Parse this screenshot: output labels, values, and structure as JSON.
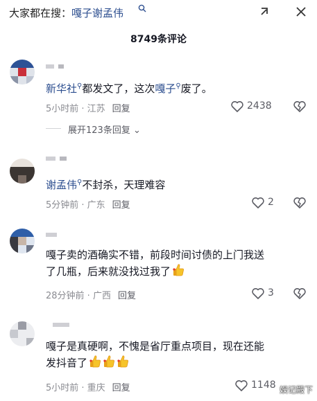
{
  "search": {
    "prefix": "大家都在搜：",
    "term": "嘎子谢孟伟"
  },
  "comment_count": "8749条评论",
  "comments": [
    {
      "author": "新华社",
      "text_main": "都发文了，这次",
      "text_mention": "嘎子",
      "text_tail": "废了。",
      "meta": "5小时前 · 江苏",
      "reply_label": "回复",
      "likes": "2438",
      "expand_label": "展开123条回复"
    },
    {
      "author": "谢孟伟",
      "text": "不封杀，天理难容",
      "meta": "5分钟前 · 广东",
      "reply_label": "回复",
      "likes": "2"
    },
    {
      "text_line1": "嘎子卖的酒确实不错，前段时间讨债的上门我送",
      "text_line2": "了几瓶，后来就没找过我了",
      "meta": "28分钟前 · 广西",
      "reply_label": "回复",
      "likes": "3"
    },
    {
      "text_line1": "嘎子是真硬啊，不愧是省厅重点项目，现在还能",
      "text_line2": "发抖音了",
      "meta": "5小时前 · 重庆",
      "reply_label": "回复",
      "likes": "1148"
    }
  ],
  "icons": {
    "expand": "expand-icon",
    "close": "close-icon",
    "search_mini": "search-icon",
    "like": "heart-outline-icon",
    "dislike": "broken-heart-icon",
    "thumb_emoji": "thumbs-up-emoji-icon"
  },
  "colors": {
    "link": "#2c4e8f",
    "meta": "#8a8b91",
    "text": "#161823"
  },
  "watermark": "娱记殿下"
}
